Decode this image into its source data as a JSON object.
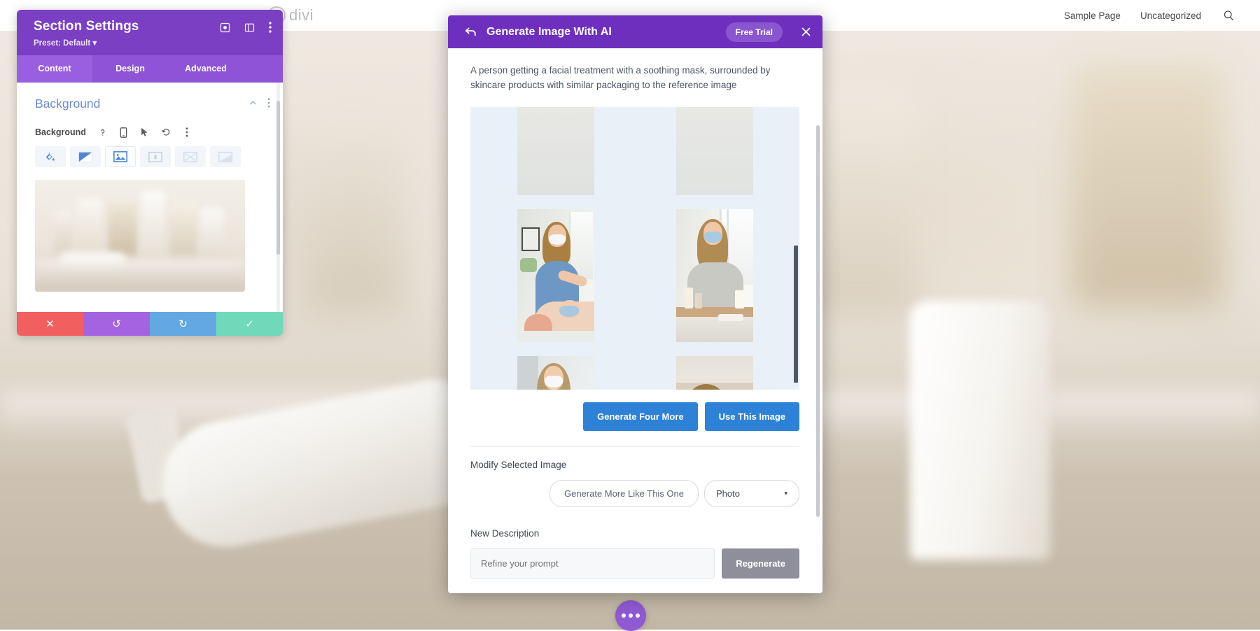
{
  "topnav": {
    "brand": "divi",
    "links": [
      {
        "label": "Sample Page"
      },
      {
        "label": "Uncategorized"
      }
    ],
    "search_icon": "search-icon"
  },
  "settings_panel": {
    "title": "Section Settings",
    "preset": "Preset: Default",
    "preset_caret": "▾",
    "header_icons": [
      {
        "name": "target-icon"
      },
      {
        "name": "layout-columns-icon"
      },
      {
        "name": "kebab-menu-icon"
      }
    ],
    "tabs": [
      {
        "label": "Content",
        "active": true
      },
      {
        "label": "Design",
        "active": false
      },
      {
        "label": "Advanced",
        "active": false
      }
    ],
    "section": {
      "title": "Background",
      "collapse_icon": "chevron-up-icon",
      "menu_icon": "kebab-menu-icon"
    },
    "field": {
      "label": "Background",
      "help_icon": "question-mark-icon",
      "responsive_icon": "mobile-device-icon",
      "hover_icon": "cursor-pointer-icon",
      "reset_icon": "undo-reset-icon",
      "more_icon": "kebab-menu-icon"
    },
    "background_types": [
      {
        "name": "background-color-icon",
        "active": false
      },
      {
        "name": "background-gradient-icon",
        "active": false
      },
      {
        "name": "background-image-icon",
        "active": true
      },
      {
        "name": "background-video-icon",
        "active": false
      },
      {
        "name": "background-pattern-icon",
        "active": false
      },
      {
        "name": "background-mask-icon",
        "active": false
      }
    ],
    "footer_actions": [
      {
        "name": "cancel-button",
        "glyph": "✕",
        "color": "#f15f5f"
      },
      {
        "name": "undo-button",
        "glyph": "↺",
        "color": "#a463e0"
      },
      {
        "name": "redo-button",
        "glyph": "↻",
        "color": "#63a8e0"
      },
      {
        "name": "save-button",
        "glyph": "✓",
        "color": "#6fd9b9"
      }
    ]
  },
  "ai_modal": {
    "back_icon": "back-arrow-icon",
    "title": "Generate Image With AI",
    "trial_badge": "Free Trial",
    "close_icon": "close-icon",
    "prompt": "A person getting a facial treatment with a soothing mask, surrounded by skincare products with similar packaging to the reference image",
    "results_count": 6,
    "buttons": {
      "generate_four_more": "Generate Four More",
      "use_this_image": "Use This Image"
    },
    "modify": {
      "label": "Modify Selected Image",
      "generate_more_like": "Generate More Like This One",
      "style_value": "Photo",
      "style_caret": "▾"
    },
    "new_description": {
      "label": "New Description",
      "input_value": "",
      "input_placeholder": "Refine your prompt",
      "regenerate_label": "Regenerate"
    }
  },
  "floating": {
    "dots_button": "page-settings-dots-button"
  },
  "colors": {
    "settings_header": "#7b3fc4",
    "settings_tabs": "#8e53d6",
    "modal_header": "#6f2fbe",
    "primary_blue": "#2d82d8",
    "trial_badge": "#8a56cf",
    "section_title": "#6c8bd6"
  }
}
